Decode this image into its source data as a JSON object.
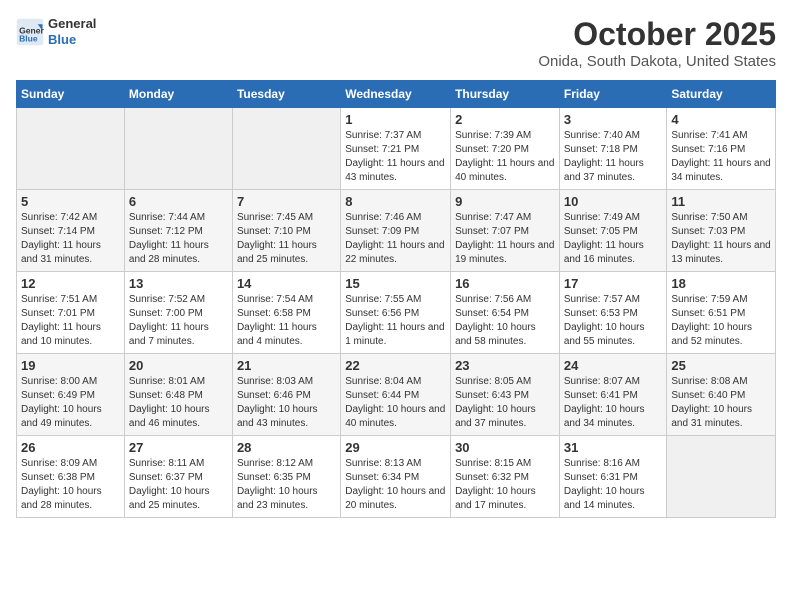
{
  "header": {
    "logo_general": "General",
    "logo_blue": "Blue",
    "title": "October 2025",
    "subtitle": "Onida, South Dakota, United States"
  },
  "days_of_week": [
    "Sunday",
    "Monday",
    "Tuesday",
    "Wednesday",
    "Thursday",
    "Friday",
    "Saturday"
  ],
  "weeks": [
    [
      {
        "day": "",
        "info": ""
      },
      {
        "day": "",
        "info": ""
      },
      {
        "day": "",
        "info": ""
      },
      {
        "day": "1",
        "info": "Sunrise: 7:37 AM\nSunset: 7:21 PM\nDaylight: 11 hours and 43 minutes."
      },
      {
        "day": "2",
        "info": "Sunrise: 7:39 AM\nSunset: 7:20 PM\nDaylight: 11 hours and 40 minutes."
      },
      {
        "day": "3",
        "info": "Sunrise: 7:40 AM\nSunset: 7:18 PM\nDaylight: 11 hours and 37 minutes."
      },
      {
        "day": "4",
        "info": "Sunrise: 7:41 AM\nSunset: 7:16 PM\nDaylight: 11 hours and 34 minutes."
      }
    ],
    [
      {
        "day": "5",
        "info": "Sunrise: 7:42 AM\nSunset: 7:14 PM\nDaylight: 11 hours and 31 minutes."
      },
      {
        "day": "6",
        "info": "Sunrise: 7:44 AM\nSunset: 7:12 PM\nDaylight: 11 hours and 28 minutes."
      },
      {
        "day": "7",
        "info": "Sunrise: 7:45 AM\nSunset: 7:10 PM\nDaylight: 11 hours and 25 minutes."
      },
      {
        "day": "8",
        "info": "Sunrise: 7:46 AM\nSunset: 7:09 PM\nDaylight: 11 hours and 22 minutes."
      },
      {
        "day": "9",
        "info": "Sunrise: 7:47 AM\nSunset: 7:07 PM\nDaylight: 11 hours and 19 minutes."
      },
      {
        "day": "10",
        "info": "Sunrise: 7:49 AM\nSunset: 7:05 PM\nDaylight: 11 hours and 16 minutes."
      },
      {
        "day": "11",
        "info": "Sunrise: 7:50 AM\nSunset: 7:03 PM\nDaylight: 11 hours and 13 minutes."
      }
    ],
    [
      {
        "day": "12",
        "info": "Sunrise: 7:51 AM\nSunset: 7:01 PM\nDaylight: 11 hours and 10 minutes."
      },
      {
        "day": "13",
        "info": "Sunrise: 7:52 AM\nSunset: 7:00 PM\nDaylight: 11 hours and 7 minutes."
      },
      {
        "day": "14",
        "info": "Sunrise: 7:54 AM\nSunset: 6:58 PM\nDaylight: 11 hours and 4 minutes."
      },
      {
        "day": "15",
        "info": "Sunrise: 7:55 AM\nSunset: 6:56 PM\nDaylight: 11 hours and 1 minute."
      },
      {
        "day": "16",
        "info": "Sunrise: 7:56 AM\nSunset: 6:54 PM\nDaylight: 10 hours and 58 minutes."
      },
      {
        "day": "17",
        "info": "Sunrise: 7:57 AM\nSunset: 6:53 PM\nDaylight: 10 hours and 55 minutes."
      },
      {
        "day": "18",
        "info": "Sunrise: 7:59 AM\nSunset: 6:51 PM\nDaylight: 10 hours and 52 minutes."
      }
    ],
    [
      {
        "day": "19",
        "info": "Sunrise: 8:00 AM\nSunset: 6:49 PM\nDaylight: 10 hours and 49 minutes."
      },
      {
        "day": "20",
        "info": "Sunrise: 8:01 AM\nSunset: 6:48 PM\nDaylight: 10 hours and 46 minutes."
      },
      {
        "day": "21",
        "info": "Sunrise: 8:03 AM\nSunset: 6:46 PM\nDaylight: 10 hours and 43 minutes."
      },
      {
        "day": "22",
        "info": "Sunrise: 8:04 AM\nSunset: 6:44 PM\nDaylight: 10 hours and 40 minutes."
      },
      {
        "day": "23",
        "info": "Sunrise: 8:05 AM\nSunset: 6:43 PM\nDaylight: 10 hours and 37 minutes."
      },
      {
        "day": "24",
        "info": "Sunrise: 8:07 AM\nSunset: 6:41 PM\nDaylight: 10 hours and 34 minutes."
      },
      {
        "day": "25",
        "info": "Sunrise: 8:08 AM\nSunset: 6:40 PM\nDaylight: 10 hours and 31 minutes."
      }
    ],
    [
      {
        "day": "26",
        "info": "Sunrise: 8:09 AM\nSunset: 6:38 PM\nDaylight: 10 hours and 28 minutes."
      },
      {
        "day": "27",
        "info": "Sunrise: 8:11 AM\nSunset: 6:37 PM\nDaylight: 10 hours and 25 minutes."
      },
      {
        "day": "28",
        "info": "Sunrise: 8:12 AM\nSunset: 6:35 PM\nDaylight: 10 hours and 23 minutes."
      },
      {
        "day": "29",
        "info": "Sunrise: 8:13 AM\nSunset: 6:34 PM\nDaylight: 10 hours and 20 minutes."
      },
      {
        "day": "30",
        "info": "Sunrise: 8:15 AM\nSunset: 6:32 PM\nDaylight: 10 hours and 17 minutes."
      },
      {
        "day": "31",
        "info": "Sunrise: 8:16 AM\nSunset: 6:31 PM\nDaylight: 10 hours and 14 minutes."
      },
      {
        "day": "",
        "info": ""
      }
    ]
  ]
}
